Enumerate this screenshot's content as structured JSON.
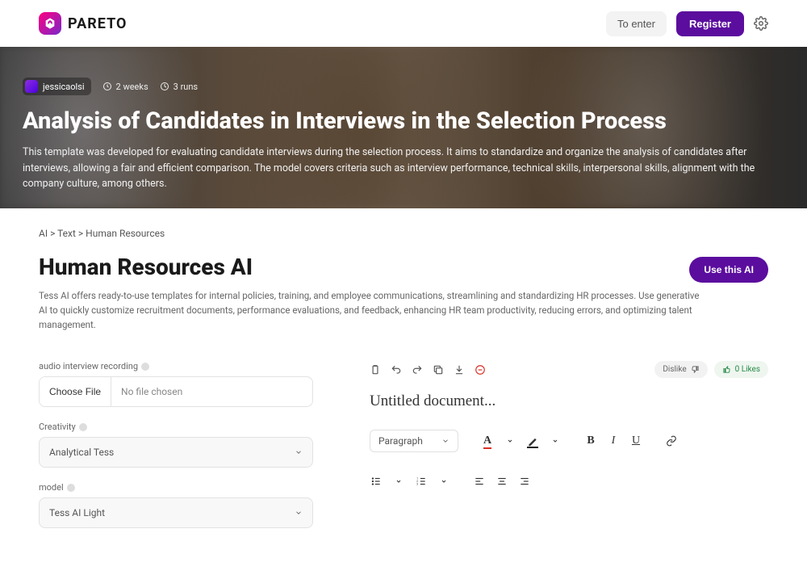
{
  "header": {
    "brand": "PARETO",
    "enter": "To enter",
    "register": "Register"
  },
  "hero": {
    "author": "jessicaolsi",
    "age": "2 weeks",
    "runs": "3 runs",
    "title": "Analysis of Candidates in Interviews in the Selection Process",
    "desc": "This template was developed for evaluating candidate interviews during the selection process. It aims to standardize and organize the analysis of candidates after interviews, allowing a fair and efficient comparison. The model covers criteria such as interview performance, technical skills, interpersonal skills, alignment with the company culture, among others."
  },
  "breadcrumb": "AI > Text > Human Resources",
  "section": {
    "title": "Human Resources AI",
    "use_btn": "Use this AI",
    "desc": "Tess AI offers ready-to-use templates for internal policies, training, and employee communications, streamlining and standardizing HR processes. Use generative AI to quickly customize recruitment documents, performance evaluations, and feedback, enhancing HR team productivity, reducing errors, and optimizing talent management."
  },
  "form": {
    "audio_label": "audio interview recording",
    "choose_file": "Choose File",
    "no_file": "No file chosen",
    "creativity_label": "Creativity",
    "creativity_value": "Analytical Tess",
    "model_label": "model",
    "model_value": "Tess AI Light"
  },
  "editor": {
    "dislike": "Dislike",
    "likes": "0 Likes",
    "doc_title": "Untitled document...",
    "paragraph": "Paragraph"
  }
}
